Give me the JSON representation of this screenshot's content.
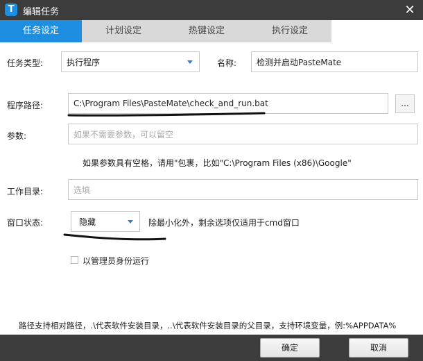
{
  "window": {
    "title": "编辑任务",
    "app_icon_letter": "T",
    "close_glyph": "✕"
  },
  "tabs": [
    {
      "label": "任务设定",
      "active": true
    },
    {
      "label": "计划设定",
      "active": false
    },
    {
      "label": "热键设定",
      "active": false
    },
    {
      "label": "执行设定",
      "active": false
    }
  ],
  "form": {
    "task_type_label": "任务类型:",
    "task_type_value": "执行程序",
    "name_label": "名称:",
    "name_value": "检测并启动PasteMate",
    "path_label": "程序路径:",
    "path_value": "C:\\Program Files\\PasteMate\\check_and_run.bat",
    "browse_label": "...",
    "params_label": "参数:",
    "params_placeholder": "如果不需要参数，可以留空",
    "params_hint": "如果参数具有空格，请用\"包裹，比如\"C:\\Program Files (x86)\\Google\"",
    "workdir_label": "工作目录:",
    "workdir_placeholder": "选填",
    "window_state_label": "窗口状态:",
    "window_state_value": "隐藏",
    "window_state_hint": "除最小化外，剩余选项仅适用于cmd窗口",
    "run_as_admin_label": "以管理员身份运行",
    "run_as_admin_checked": false,
    "footer_hint": "路径支持相对路径，.\\代表软件安装目录，..\\代表软件安装目录的父目录，支持环境变量，例:%APPDATA%"
  },
  "buttons": {
    "ok": "确定",
    "cancel": "取消"
  },
  "colors": {
    "accent": "#1e8fe0",
    "titlebar": "#3c3c3c",
    "tab_inactive": "#d9d9d9"
  }
}
